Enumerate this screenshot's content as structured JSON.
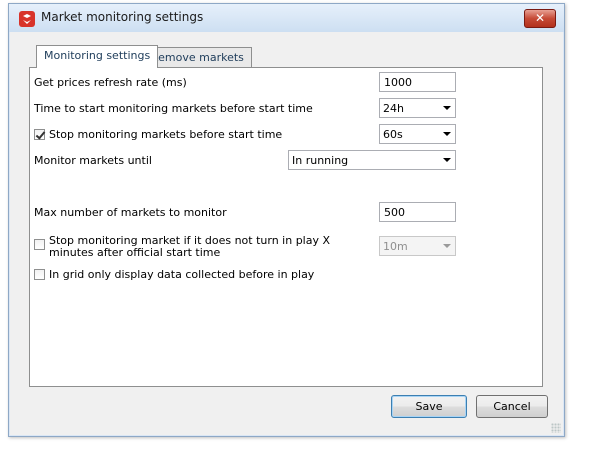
{
  "window": {
    "title": "Market monitoring settings",
    "close_glyph": "✕"
  },
  "tabs": [
    {
      "label": "Monitoring settings"
    },
    {
      "label": "Remove markets"
    }
  ],
  "settings": {
    "refresh_rate": {
      "label": "Get prices refresh rate (ms)",
      "value": "1000"
    },
    "start_time": {
      "label": "Time to start monitoring markets before start time",
      "value": "24h"
    },
    "stop_before": {
      "label": "Stop monitoring markets before start time",
      "checked": true,
      "value": "60s"
    },
    "monitor_until": {
      "label": "Monitor markets until",
      "value": "In running"
    },
    "max_markets": {
      "label": "Max number of markets to monitor",
      "value": "500"
    },
    "stop_not_inplay": {
      "label": "Stop monitoring market if it does not turn in play X minutes after official start time",
      "checked": false,
      "value": "10m"
    },
    "grid_only": {
      "label": "In grid only display data collected before in play",
      "checked": false
    }
  },
  "buttons": {
    "save": "Save",
    "cancel": "Cancel"
  },
  "colors": {
    "app_icon": "#d8332a",
    "close_button": "#c64a36",
    "title_bar": "#dbe7f5"
  }
}
